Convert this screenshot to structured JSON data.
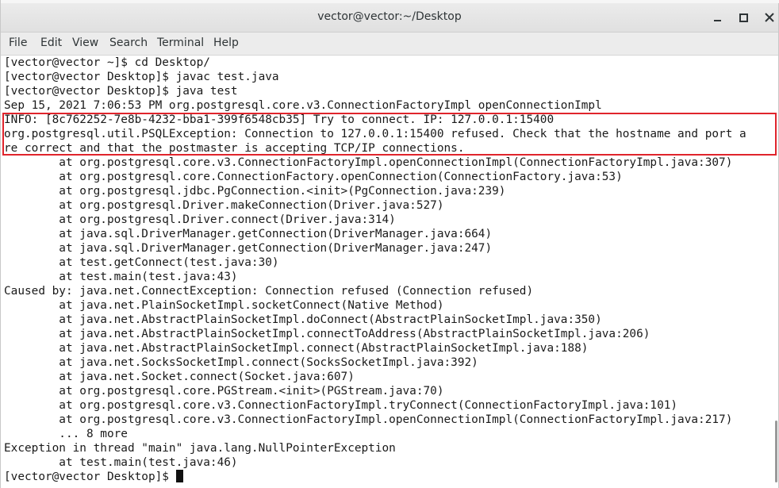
{
  "window": {
    "title": "vector@vector:~/Desktop",
    "controls": {
      "minimize": "minimize-icon",
      "maximize": "maximize-icon",
      "close": "close-icon"
    }
  },
  "menubar": {
    "items": [
      "File",
      "Edit",
      "View",
      "Search",
      "Terminal",
      "Help"
    ]
  },
  "terminal": {
    "lines": [
      "[vector@vector ~]$ cd Desktop/",
      "[vector@vector Desktop]$ javac test.java",
      "[vector@vector Desktop]$ java test",
      "Sep 15, 2021 7:06:53 PM org.postgresql.core.v3.ConnectionFactoryImpl openConnectionImpl",
      "INFO: [8c762252-7e8b-4232-bba1-399f6548cb35] Try to connect. IP: 127.0.0.1:15400",
      "org.postgresql.util.PSQLException: Connection to 127.0.0.1:15400 refused. Check that the hostname and port a",
      "re correct and that the postmaster is accepting TCP/IP connections.",
      "        at org.postgresql.core.v3.ConnectionFactoryImpl.openConnectionImpl(ConnectionFactoryImpl.java:307)",
      "        at org.postgresql.core.ConnectionFactory.openConnection(ConnectionFactory.java:53)",
      "        at org.postgresql.jdbc.PgConnection.<init>(PgConnection.java:239)",
      "        at org.postgresql.Driver.makeConnection(Driver.java:527)",
      "        at org.postgresql.Driver.connect(Driver.java:314)",
      "        at java.sql.DriverManager.getConnection(DriverManager.java:664)",
      "        at java.sql.DriverManager.getConnection(DriverManager.java:247)",
      "        at test.getConnect(test.java:30)",
      "        at test.main(test.java:43)",
      "Caused by: java.net.ConnectException: Connection refused (Connection refused)",
      "        at java.net.PlainSocketImpl.socketConnect(Native Method)",
      "        at java.net.AbstractPlainSocketImpl.doConnect(AbstractPlainSocketImpl.java:350)",
      "        at java.net.AbstractPlainSocketImpl.connectToAddress(AbstractPlainSocketImpl.java:206)",
      "        at java.net.AbstractPlainSocketImpl.connect(AbstractPlainSocketImpl.java:188)",
      "        at java.net.SocksSocketImpl.connect(SocksSocketImpl.java:392)",
      "        at java.net.Socket.connect(Socket.java:607)",
      "        at org.postgresql.core.PGStream.<init>(PGStream.java:70)",
      "        at org.postgresql.core.v3.ConnectionFactoryImpl.tryConnect(ConnectionFactoryImpl.java:101)",
      "        at org.postgresql.core.v3.ConnectionFactoryImpl.openConnectionImpl(ConnectionFactoryImpl.java:217)",
      "        ... 8 more",
      "Exception in thread \"main\" java.lang.NullPointerException",
      "        at test.main(test.java:46)",
      "[vector@vector Desktop]$ "
    ],
    "highlight_color": "#e0242c"
  }
}
